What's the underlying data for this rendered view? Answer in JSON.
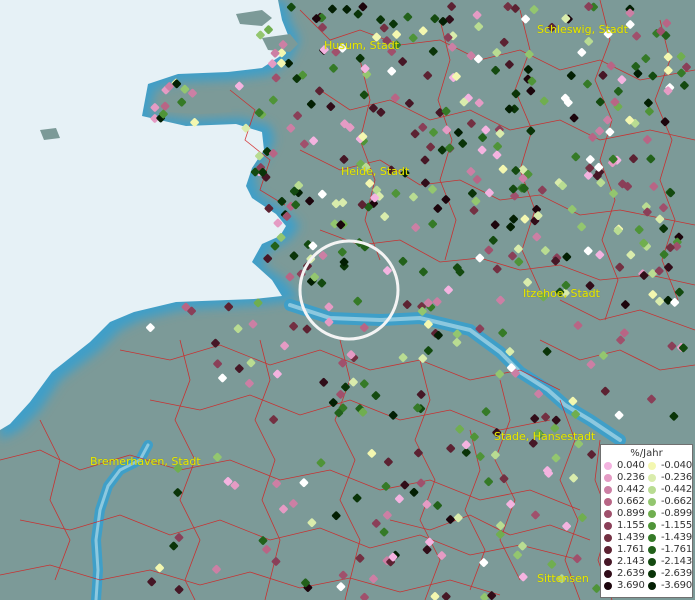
{
  "legend": {
    "title": "%/Jahr",
    "positive": [
      {
        "label": "0.040",
        "color": "#f4b3e0"
      },
      {
        "label": "0.236",
        "color": "#e59bc4"
      },
      {
        "label": "0.442",
        "color": "#cc7fa4"
      },
      {
        "label": "0.662",
        "color": "#b86585"
      },
      {
        "label": "0.899",
        "color": "#a0506c"
      },
      {
        "label": "1.155",
        "color": "#8a3f58"
      },
      {
        "label": "1.439",
        "color": "#733042"
      },
      {
        "label": "1.761",
        "color": "#5c2232"
      },
      {
        "label": "2.143",
        "color": "#461726"
      },
      {
        "label": "2.639",
        "color": "#310d19"
      },
      {
        "label": "3.690",
        "color": "#1c050c"
      }
    ],
    "negative": [
      {
        "label": "-0.040",
        "color": "#f3f7b0"
      },
      {
        "label": "-0.236",
        "color": "#d9ecac"
      },
      {
        "label": "-0.442",
        "color": "#b9dc92"
      },
      {
        "label": "-0.662",
        "color": "#93c66f"
      },
      {
        "label": "-0.899",
        "color": "#70ae4f"
      },
      {
        "label": "-1.155",
        "color": "#4f9438"
      },
      {
        "label": "-1.439",
        "color": "#357a27"
      },
      {
        "label": "-1.761",
        "color": "#22611a"
      },
      {
        "label": "-2.143",
        "color": "#144a10"
      },
      {
        "label": "-2.639",
        "color": "#0a3408"
      },
      {
        "label": "-3.690",
        "color": "#031f03"
      }
    ]
  },
  "cities": [
    {
      "name": "Husum, Stadt"
    },
    {
      "name": "Schleswig, Stadt"
    },
    {
      "name": "Heide, Stadt"
    },
    {
      "name": "Itzehoe, Stadt"
    },
    {
      "name": "Stade, Hansestadt"
    },
    {
      "name": "Bremerhaven, Stadt"
    },
    {
      "name": "Sittensen"
    }
  ],
  "colors": {
    "sea": "#e4f0f5",
    "land": "#7c9a98",
    "river": "#3f9fc8",
    "boundaries": "#d42020",
    "city_label": "#e8e800"
  }
}
